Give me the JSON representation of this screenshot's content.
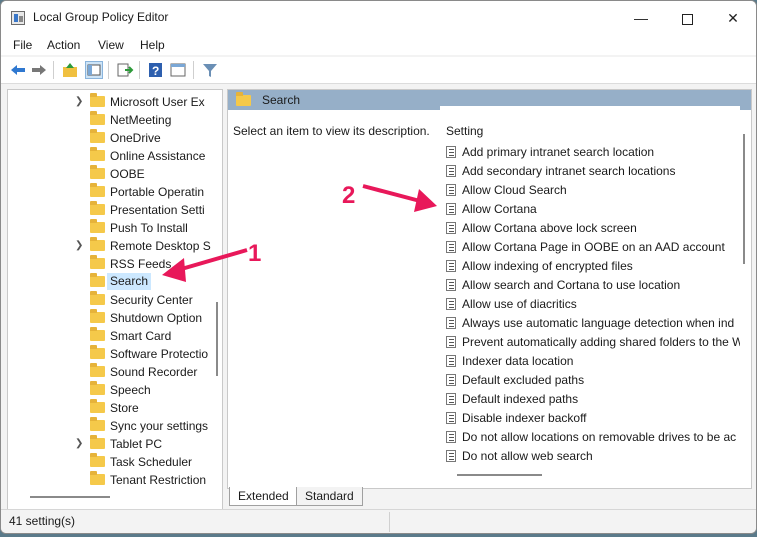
{
  "window": {
    "title": "Local Group Policy Editor",
    "minimize_icon": "minimize-icon",
    "maximize_icon": "maximize-icon",
    "close_icon": "close-icon"
  },
  "menu": [
    "File",
    "Action",
    "View",
    "Help"
  ],
  "toolbar": [
    "back-arrow-icon",
    "forward-arrow-icon",
    "up-folder-icon",
    "show-hide-tree-icon",
    "export-list-icon",
    "help-icon",
    "properties-icon",
    "filter-icon"
  ],
  "tree": {
    "items": [
      {
        "label": "Microsoft User Ex",
        "expandable": true
      },
      {
        "label": "NetMeeting",
        "expandable": false
      },
      {
        "label": "OneDrive",
        "expandable": false
      },
      {
        "label": "Online Assistance",
        "expandable": false
      },
      {
        "label": "OOBE",
        "expandable": false
      },
      {
        "label": "Portable Operatin",
        "expandable": false
      },
      {
        "label": "Presentation Setti",
        "expandable": false
      },
      {
        "label": "Push To Install",
        "expandable": false
      },
      {
        "label": "Remote Desktop S",
        "expandable": true
      },
      {
        "label": "RSS Feeds",
        "expandable": false
      },
      {
        "label": "Search",
        "expandable": false,
        "selected": true
      },
      {
        "label": "Security Center",
        "expandable": false
      },
      {
        "label": "Shutdown Option",
        "expandable": false
      },
      {
        "label": "Smart Card",
        "expandable": false
      },
      {
        "label": "Software Protectio",
        "expandable": false
      },
      {
        "label": "Sound Recorder",
        "expandable": false
      },
      {
        "label": "Speech",
        "expandable": false
      },
      {
        "label": "Store",
        "expandable": false
      },
      {
        "label": "Sync your settings",
        "expandable": false
      },
      {
        "label": "Tablet PC",
        "expandable": true
      },
      {
        "label": "Task Scheduler",
        "expandable": false
      },
      {
        "label": "Tenant Restriction",
        "expandable": false
      }
    ]
  },
  "details": {
    "header_title": "Search",
    "description": "Select an item to view its description.",
    "column_header": "Setting",
    "settings": [
      "Add primary intranet search location",
      "Add secondary intranet search locations",
      "Allow Cloud Search",
      "Allow Cortana",
      "Allow Cortana above lock screen",
      "Allow Cortana Page in OOBE on an AAD account",
      "Allow indexing of encrypted files",
      "Allow search and Cortana to use location",
      "Allow use of diacritics",
      "Always use automatic language detection when ind",
      "Prevent automatically adding shared folders to the W",
      "Indexer data location",
      "Default excluded paths",
      "Default indexed paths",
      "Disable indexer backoff",
      "Do not allow locations on removable drives to be ac",
      "Do not allow web search"
    ]
  },
  "tabs": [
    "Extended",
    "Standard"
  ],
  "status": "41 setting(s)",
  "annotations": {
    "marker1": "1",
    "marker2": "2",
    "color": "#e8185a"
  }
}
